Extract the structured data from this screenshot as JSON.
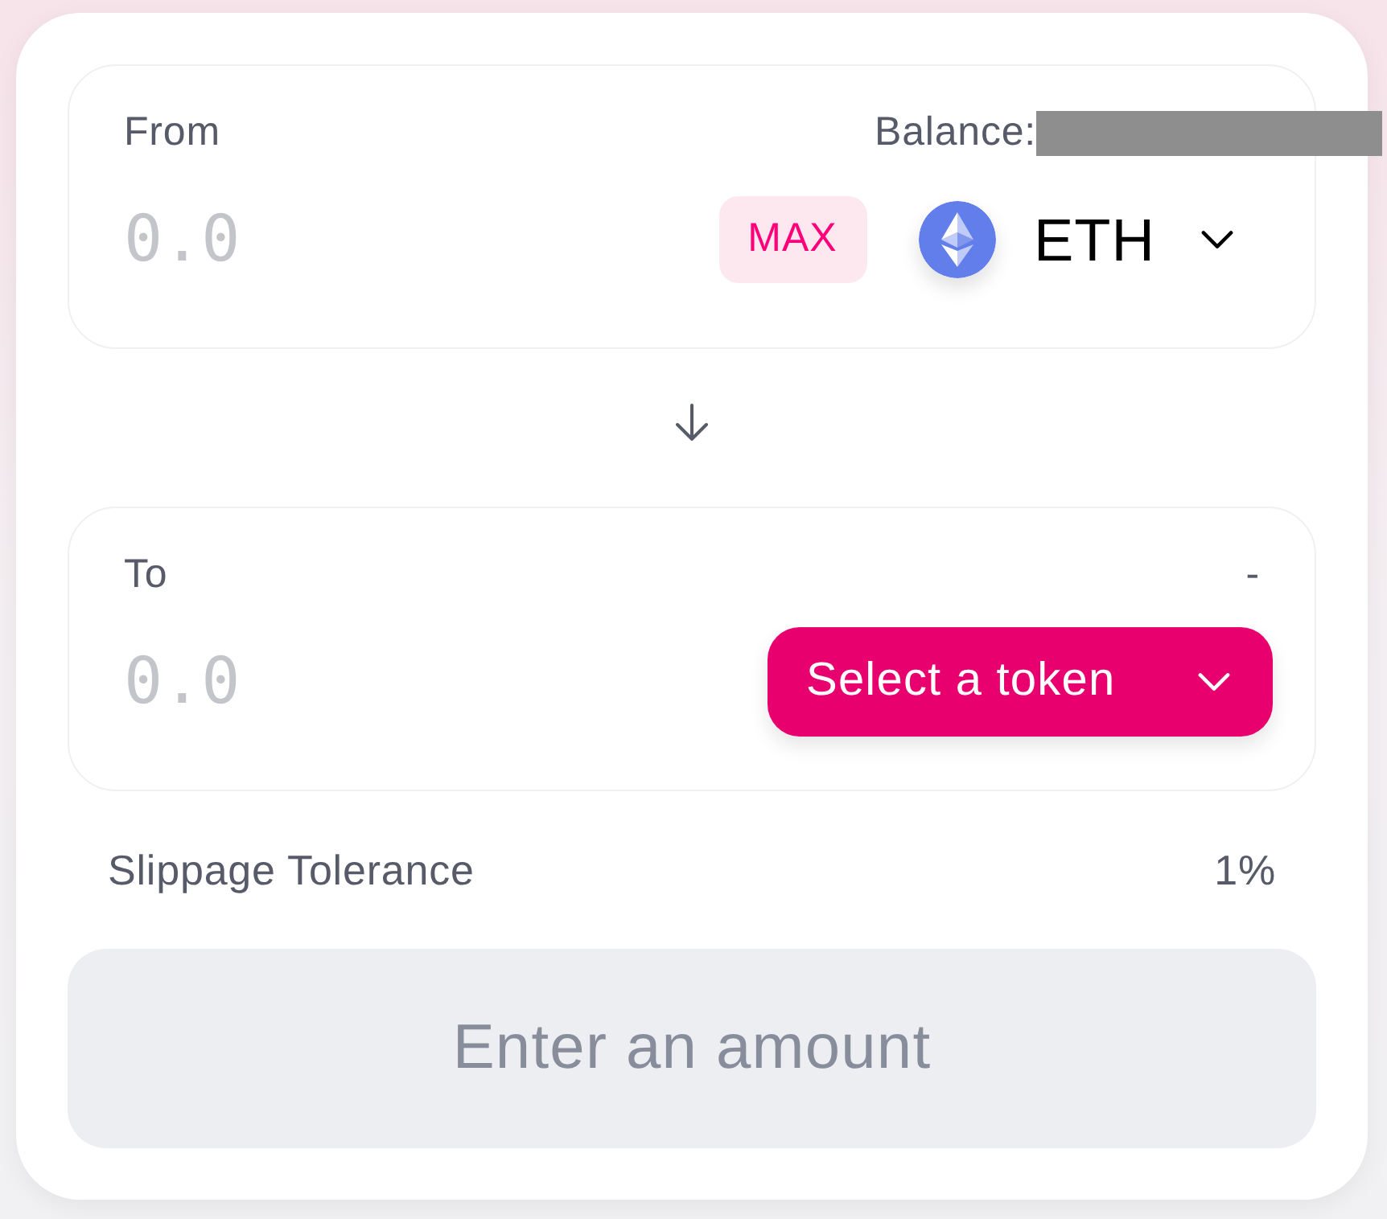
{
  "panels": [
    {
      "label": "From",
      "balance": {
        "label": "Balance:",
        "redacted": true
      },
      "amount": {
        "placeholder": "0.0"
      },
      "max_button": "MAX",
      "token": {
        "kind": "selected",
        "symbol": "ETH"
      }
    },
    {
      "label": "To",
      "balance": {
        "label": "-",
        "redacted": false
      },
      "amount": {
        "placeholder": "0.0"
      },
      "token": {
        "kind": "prompt",
        "label": "Select a token"
      }
    }
  ],
  "slippage": {
    "label": "Slippage Tolerance",
    "value": "1%"
  },
  "submit": {
    "label": "Enter an amount",
    "disabled": true
  }
}
